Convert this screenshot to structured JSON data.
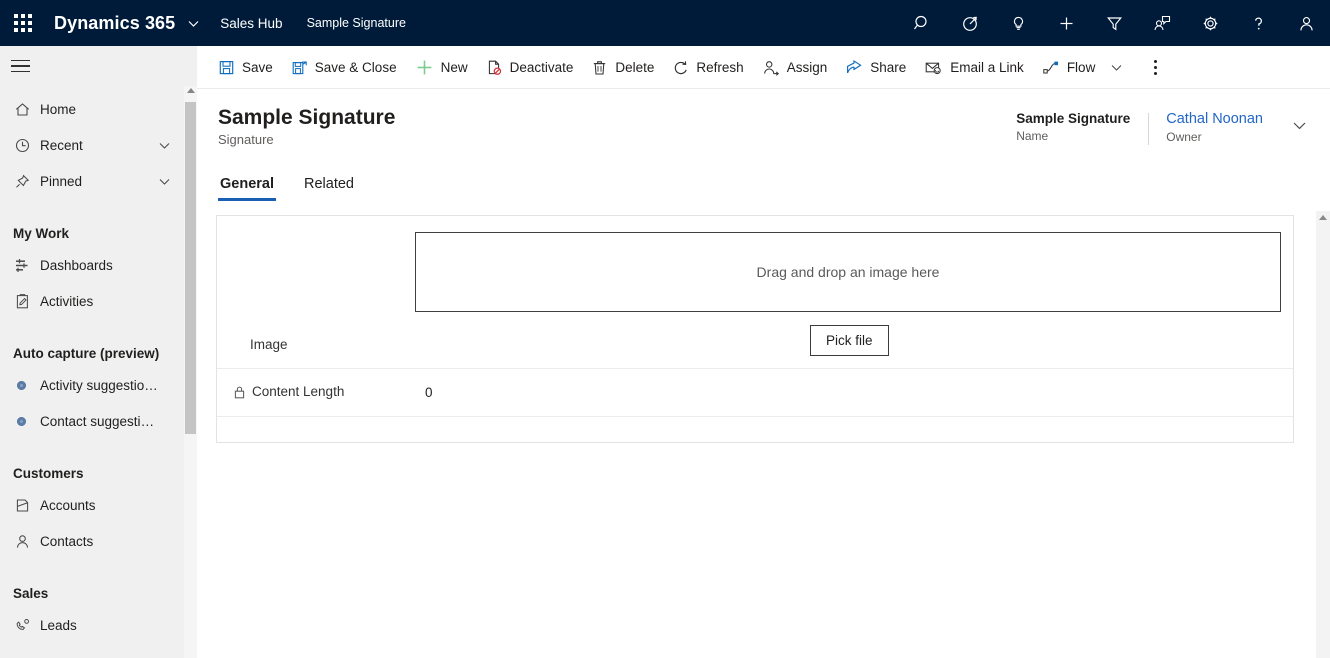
{
  "topbar": {
    "waffle_label": "app-launcher",
    "brand": "Dynamics 365",
    "app_name": "Sales Hub",
    "breadcrumb_record": "Sample Signature",
    "icons": [
      {
        "name": "search-icon",
        "title": "Search"
      },
      {
        "name": "diagnostics-icon",
        "title": "Diagnostics"
      },
      {
        "name": "lightbulb-icon",
        "title": "Insights"
      },
      {
        "name": "plus-icon",
        "title": "Quick create"
      },
      {
        "name": "filter-icon",
        "title": "Filter"
      },
      {
        "name": "assistant-icon",
        "title": "Assistant"
      },
      {
        "name": "gear-icon",
        "title": "Settings"
      },
      {
        "name": "help-icon",
        "title": "Help"
      },
      {
        "name": "user-avatar-icon",
        "title": "Account manager"
      }
    ]
  },
  "sidebar": {
    "hamburger_label": "Expand / Collapse site map",
    "items": [
      {
        "label": "Home",
        "icon": "home-icon",
        "chevron": false
      },
      {
        "label": "Recent",
        "icon": "clock-icon",
        "chevron": true
      },
      {
        "label": "Pinned",
        "icon": "pin-icon",
        "chevron": true
      }
    ],
    "groups": [
      {
        "title": "My Work",
        "items": [
          {
            "label": "Dashboards",
            "icon": "dashboards-icon"
          },
          {
            "label": "Activities",
            "icon": "activities-icon"
          }
        ]
      },
      {
        "title": "Auto capture (preview)",
        "items": [
          {
            "label": "Activity suggestions",
            "icon": "bullet-dot-icon"
          },
          {
            "label": "Contact suggestio...",
            "icon": "bullet-dot-icon"
          }
        ]
      },
      {
        "title": "Customers",
        "items": [
          {
            "label": "Accounts",
            "icon": "accounts-icon"
          },
          {
            "label": "Contacts",
            "icon": "contacts-icon"
          }
        ]
      },
      {
        "title": "Sales",
        "items": [
          {
            "label": "Leads",
            "icon": "leads-icon"
          }
        ]
      }
    ]
  },
  "commandbar": {
    "buttons": [
      {
        "label": "Save",
        "icon": "save-icon"
      },
      {
        "label": "Save & Close",
        "icon": "save-and-close-icon"
      },
      {
        "label": "New",
        "icon": "plus-icon"
      },
      {
        "label": "Deactivate",
        "icon": "deactivate-icon"
      },
      {
        "label": "Delete",
        "icon": "trash-icon"
      },
      {
        "label": "Refresh",
        "icon": "refresh-icon"
      },
      {
        "label": "Assign",
        "icon": "assign-icon"
      },
      {
        "label": "Share",
        "icon": "share-icon"
      },
      {
        "label": "Email a Link",
        "icon": "email-link-icon"
      },
      {
        "label": "Flow",
        "icon": "flow-icon",
        "has_chevron": true
      }
    ],
    "overflow_label": "More commands"
  },
  "form": {
    "title": "Sample Signature",
    "subtitle": "Signature",
    "header_fields": [
      {
        "value": "Sample Signature",
        "label": "Name",
        "is_link": false
      },
      {
        "value": "Cathal Noonan",
        "label": "Owner",
        "is_link": true
      }
    ],
    "header_expand_label": "Expand header",
    "tabs": [
      {
        "label": "General",
        "active": true
      },
      {
        "label": "Related",
        "active": false
      }
    ],
    "dropzone_text": "Drag and drop an image here",
    "image_field_label": "Image",
    "pick_file_label": "Pick file",
    "content_length_label": "Content Length",
    "content_length_value": "0"
  },
  "colors": {
    "nav_navy": "#001b3a",
    "accent_blue": "#1a5fb4",
    "link_blue": "#2266c7",
    "new_green": "#7ccb8f",
    "deactivate_red": "#d13438",
    "sidebar_bg": "#f0f0f0",
    "bullet_blue": "#5b7ca6"
  },
  "scrollbars": {
    "sidebar_scroll_name": "sidebar-scrollbar",
    "form_scroll_name": "form-scrollbar"
  }
}
